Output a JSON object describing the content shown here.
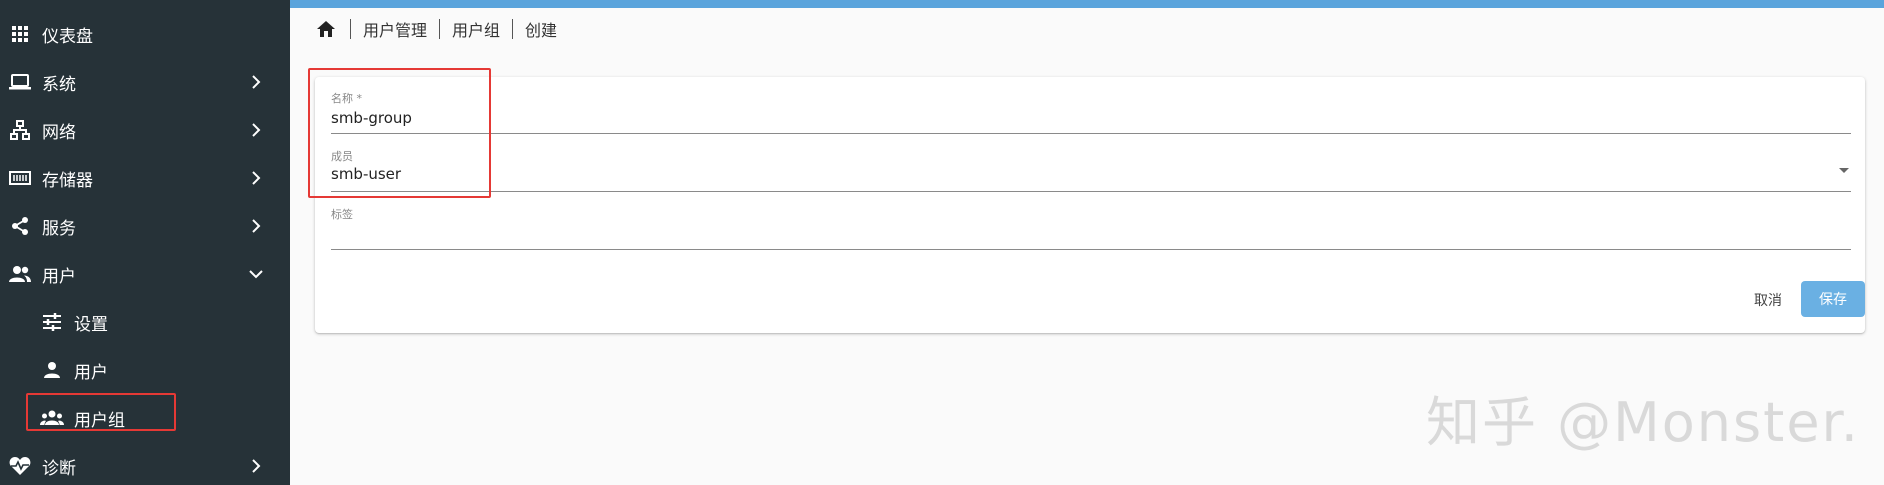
{
  "sidebar": {
    "items": [
      {
        "label": "仪表盘",
        "icon": "apps-grid-icon"
      },
      {
        "label": "系统",
        "icon": "laptop-icon"
      },
      {
        "label": "网络",
        "icon": "network-icon"
      },
      {
        "label": "存储器",
        "icon": "storage-icon"
      },
      {
        "label": "服务",
        "icon": "share-icon"
      },
      {
        "label": "用户",
        "icon": "users-icon",
        "expanded": true
      },
      {
        "label": "设置",
        "icon": "sliders-icon"
      },
      {
        "label": "用户",
        "icon": "user-icon"
      },
      {
        "label": "用户组",
        "icon": "group-icon",
        "active": true
      },
      {
        "label": "诊断",
        "icon": "heart-pulse-icon"
      }
    ]
  },
  "breadcrumb": {
    "home_icon": "home-icon",
    "items": [
      "用户管理",
      "用户组",
      "创建"
    ]
  },
  "form": {
    "name": {
      "label": "名称 *",
      "value": "smb-group"
    },
    "members": {
      "label": "成员",
      "value": "smb-user"
    },
    "tags": {
      "label": "标签",
      "value": ""
    },
    "cancel_label": "取消",
    "save_label": "保存"
  },
  "watermark": "知乎 @Monster.",
  "colors": {
    "sidebar_bg": "#263238",
    "accent": "#5aa4dc",
    "save_button": "#6ab0e3",
    "highlight_box": "#e53935"
  }
}
